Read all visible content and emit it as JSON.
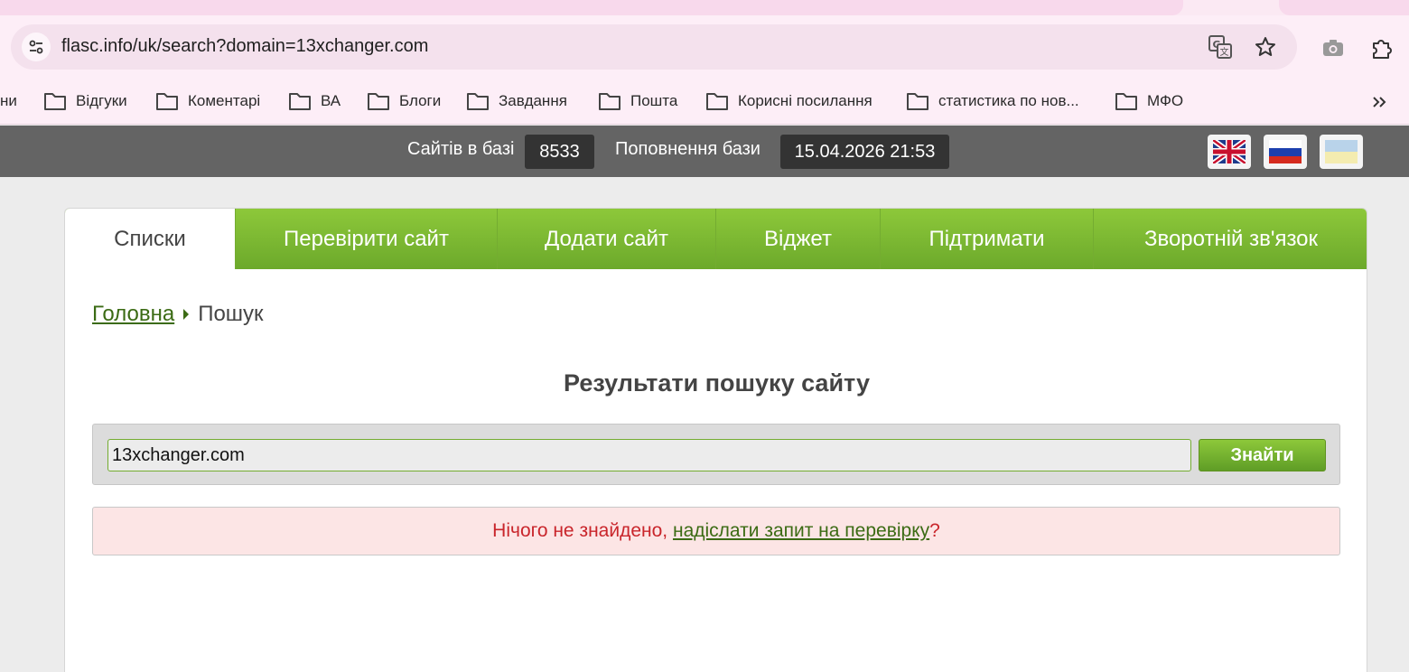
{
  "browser": {
    "url": "flasc.info/uk/search?domain=13xchanger.com",
    "bookmarks_cut_label": "ни",
    "bookmarks": [
      {
        "label": "Відгуки"
      },
      {
        "label": "Коментарі"
      },
      {
        "label": "ВА"
      },
      {
        "label": "Блоги"
      },
      {
        "label": "Завдання"
      },
      {
        "label": "Пошта"
      },
      {
        "label": "Корисні посилання"
      },
      {
        "label": "статистика по нов..."
      },
      {
        "label": "МФО"
      }
    ],
    "icons": {
      "site_info": "tune-icon",
      "translate": "translate-icon",
      "bookmark": "star-icon",
      "screenshot": "camera-icon",
      "extensions": "puzzle-icon",
      "more": "chevron-double-right-icon"
    }
  },
  "sitebar": {
    "sites_label": "Сайтів в базі",
    "sites_count": "8533",
    "update_label": "Поповнення бази",
    "update_datetime": "15.04.2026 21:53",
    "languages": [
      "uk-flag-icon",
      "ru-flag-icon",
      "ua-flag-icon"
    ]
  },
  "nav": {
    "items": [
      {
        "label": "Списки"
      },
      {
        "label": "Перевірити сайт"
      },
      {
        "label": "Додати сайт"
      },
      {
        "label": "Віджет"
      },
      {
        "label": "Підтримати"
      },
      {
        "label": "Зворотній зв'язок"
      }
    ]
  },
  "breadcrumb": {
    "home": "Головна",
    "current": "Пошук"
  },
  "page": {
    "title": "Результати пошуку сайту"
  },
  "search": {
    "value": "13xchanger.com",
    "button": "Знайти"
  },
  "alert": {
    "text_before": "Нічого не знайдено, ",
    "link": "надіслати запит на перевірку",
    "text_after": "?"
  },
  "colors": {
    "accent_green": "#7ab833",
    "link_green": "#3b6b14",
    "error_red": "#c9252b",
    "alert_bg": "#fce5e5"
  }
}
